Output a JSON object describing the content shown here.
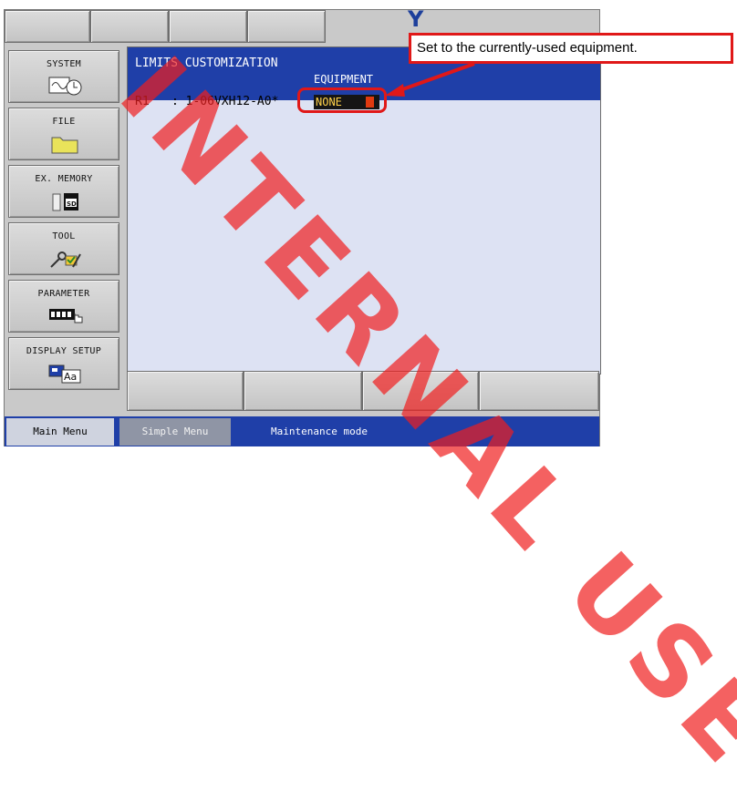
{
  "header": {
    "tabs": [
      "",
      "",
      "",
      ""
    ],
    "logo_text": "Y"
  },
  "sidebar": {
    "items": [
      {
        "label": "SYSTEM",
        "icon": "system-clock-icon"
      },
      {
        "label": "FILE",
        "icon": "folder-icon"
      },
      {
        "label": "EX. MEMORY",
        "icon": "sd-card-icon"
      },
      {
        "label": "TOOL",
        "icon": "tool-icon"
      },
      {
        "label": "PARAMETER",
        "icon": "parameter-icon"
      },
      {
        "label": "DISPLAY SETUP",
        "icon": "display-setup-icon"
      }
    ]
  },
  "main": {
    "title": "LIMITS CUSTOMIZATION",
    "column_header": "EQUIPMENT",
    "row": {
      "axis": "R1",
      "model": ": 1-06VXH12-A0*",
      "equipment_value": "NONE"
    }
  },
  "status_bar": {
    "main_menu": "Main Menu",
    "simple_menu": "Simple Menu",
    "mode": "Maintenance mode"
  },
  "annotation": {
    "callout": "Set to the currently-used equipment.",
    "watermark": "INTERNAL USE"
  },
  "colors": {
    "header_blue": "#1f3fa8",
    "content_bg": "#dde2f3",
    "annotation_red": "#e01818"
  }
}
